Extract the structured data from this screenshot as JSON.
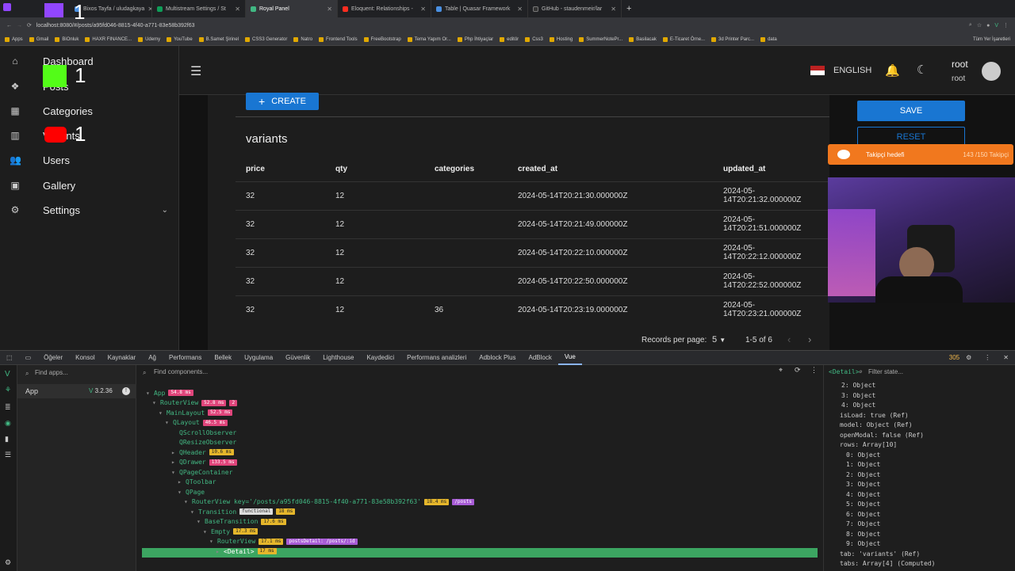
{
  "browser": {
    "tabs": [
      {
        "label": "Bixos Tayfa / uludagkaya"
      },
      {
        "label": "Multistream Settings / St"
      },
      {
        "label": "Royal Panel"
      },
      {
        "label": "Eloquent: Relationships -"
      },
      {
        "label": "Table | Quasar Framework"
      },
      {
        "label": "GitHub - staudenmeir/lar"
      }
    ],
    "url": "localhost:8080/#/posts/a95fd046-8815-4f40-a771-83e58b392f63",
    "bookmarks": [
      "Apps",
      "Gmail",
      "BiOnluk",
      "HAXR FINANCE...",
      "Udemy",
      "YouTube",
      "B.Samet Şirinel",
      "CSS3 Generator",
      "Natro",
      "Frontend Tools",
      "FreeBootstrap",
      "Tema Yapım Or...",
      "Php İhtiyaçlar",
      "editör",
      "Css3",
      "Hosting",
      "SummerNotePr...",
      "Basilacak",
      "E-Ticaret Örne...",
      "3d Printer Parc...",
      "data"
    ],
    "bookmarks_right": "Tüm Yer İşaretleri"
  },
  "overlay_counts": {
    "twitch": "1",
    "kick": "1",
    "youtube": "1"
  },
  "sidebar": {
    "items": [
      {
        "label": "Dashboard"
      },
      {
        "label": "Posts"
      },
      {
        "label": "Categories"
      },
      {
        "label": "Variants"
      },
      {
        "label": "Users"
      },
      {
        "label": "Gallery"
      },
      {
        "label": "Settings"
      }
    ]
  },
  "header": {
    "language": "ENGLISH",
    "user_name": "root",
    "user_role": "root"
  },
  "content": {
    "create_label": "CREATE",
    "section_title": "variants",
    "columns": [
      "price",
      "qty",
      "categories",
      "created_at",
      "updated_at"
    ],
    "rows": [
      [
        "32",
        "12",
        "",
        "2024-05-14T20:21:30.000000Z",
        "2024-05-14T20:21:32.000000Z"
      ],
      [
        "32",
        "12",
        "",
        "2024-05-14T20:21:49.000000Z",
        "2024-05-14T20:21:51.000000Z"
      ],
      [
        "32",
        "12",
        "",
        "2024-05-14T20:22:10.000000Z",
        "2024-05-14T20:22:12.000000Z"
      ],
      [
        "32",
        "12",
        "",
        "2024-05-14T20:22:50.000000Z",
        "2024-05-14T20:22:52.000000Z"
      ],
      [
        "32",
        "12",
        "36",
        "2024-05-14T20:23:19.000000Z",
        "2024-05-14T20:23:21.000000Z"
      ]
    ],
    "records_label": "Records per page:",
    "records_value": "5",
    "range_label": "1-5 of 6",
    "save_label": "SAVE",
    "reset_label": "RESET"
  },
  "follower_goal": {
    "label": "Takipçi hedefi",
    "value": "143 /150 Takipçi"
  },
  "devtools": {
    "tabs": [
      "Öğeler",
      "Konsol",
      "Kaynaklar",
      "Ağ",
      "Performans",
      "Bellek",
      "Uygulama",
      "Güvenlik",
      "Lighthouse",
      "Kaydedici",
      "Performans analizleri",
      "Adblock Plus",
      "AdBlock",
      "Vue"
    ],
    "active_tab": "Vue",
    "warnings": "305",
    "find_apps": "Find apps...",
    "app_name": "App",
    "vue_version": "3.2.36",
    "find_components": "Find components...",
    "filter_state": "Filter state...",
    "detail_tag": "<Detail>",
    "tree": [
      {
        "name": "App",
        "badges": [
          [
            "54.8 ms",
            "red"
          ]
        ]
      },
      {
        "name": "RouterView",
        "badges": [
          [
            "52.8 ms",
            "red"
          ],
          [
            "2",
            "red"
          ]
        ]
      },
      {
        "name": "MainLayout",
        "badges": [
          [
            "52.5 ms",
            "red"
          ]
        ]
      },
      {
        "name": "QLayout",
        "badges": [
          [
            "46.5 ms",
            "red"
          ]
        ]
      },
      {
        "name": "QScrollObserver",
        "badges": []
      },
      {
        "name": "QResizeObserver",
        "badges": []
      },
      {
        "name": "QHeader",
        "badges": [
          [
            "10.6 ms",
            "yel"
          ]
        ]
      },
      {
        "name": "QDrawer",
        "badges": [
          [
            "133.5 ms",
            "red"
          ]
        ]
      },
      {
        "name": "QPageContainer",
        "badges": []
      },
      {
        "name": "QToolbar",
        "badges": []
      },
      {
        "name": "QPage",
        "badges": []
      },
      {
        "name": "RouterView key='/posts/a95fd046-8815-4f40-a771-83e58b392f63'",
        "badges": [
          [
            "18.4 ms",
            "yel"
          ],
          [
            "/posts",
            "pur"
          ]
        ]
      },
      {
        "name": "Transition",
        "badges": [
          [
            "functional",
            "wht"
          ],
          [
            "18 ms",
            "yel"
          ]
        ]
      },
      {
        "name": "BaseTransition",
        "badges": [
          [
            "17.6 ms",
            "yel"
          ]
        ]
      },
      {
        "name": "Empty",
        "badges": [
          [
            "17.3 ms",
            "yel"
          ]
        ]
      },
      {
        "name": "RouterView",
        "badges": [
          [
            "17.1 ms",
            "yel"
          ],
          [
            "postsDetail: /posts/:id",
            "pur"
          ]
        ]
      },
      {
        "name": "<Detail>",
        "badges": [
          [
            "17 ms",
            "yel"
          ]
        ]
      }
    ],
    "state_rows": [
      "2: Object",
      "3: Object",
      "4: Object",
      "isLoad: true (Ref)",
      "model: Object (Ref)",
      "openModal: false (Ref)",
      "rows: Array[10]",
      "0: Object",
      "1: Object",
      "2: Object",
      "3: Object",
      "4: Object",
      "5: Object",
      "6: Object",
      "7: Object",
      "8: Object",
      "9: Object",
      "tab: 'variants' (Ref)",
      "tabs: Array[4] (Computed)"
    ]
  }
}
